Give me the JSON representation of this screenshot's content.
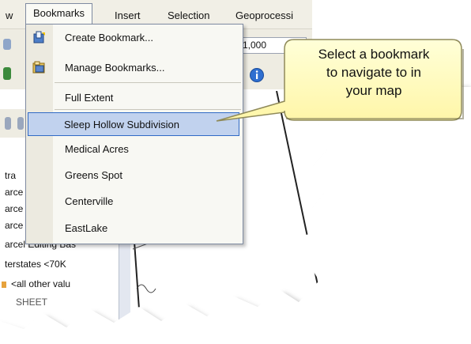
{
  "menubar": {
    "items": [
      {
        "label": "w"
      },
      {
        "label": "Bookmarks"
      },
      {
        "label": "Insert"
      },
      {
        "label": "Selection"
      },
      {
        "label": "Geoprocessi"
      }
    ]
  },
  "toolbar": {
    "scale_value": "1,000"
  },
  "bookmarks_menu": {
    "items": [
      {
        "label": "Create Bookmark...",
        "icon": "create-bookmark-icon"
      },
      {
        "label": "Manage Bookmarks...",
        "icon": "manage-bookmarks-icon"
      },
      {
        "label": "Full Extent"
      },
      {
        "label": "Sleep Hollow Subdivision",
        "selected": true
      },
      {
        "label": "Medical Acres"
      },
      {
        "label": "Greens Spot"
      },
      {
        "label": "Centerville"
      },
      {
        "label": "EastLake"
      }
    ]
  },
  "toc": {
    "rows": [
      "tra",
      "arce",
      "arce",
      "arce",
      "arcel Editing Bas",
      "terstates <70K",
      "<all other valu",
      "SHEET"
    ]
  },
  "callout": {
    "lines": [
      "Select a bookmark",
      "to navigate to in",
      "your map"
    ]
  },
  "colors": {
    "selected_bg": "#c1d2ee",
    "selected_border": "#316ac5",
    "callout_fill": "#ffffc8"
  }
}
